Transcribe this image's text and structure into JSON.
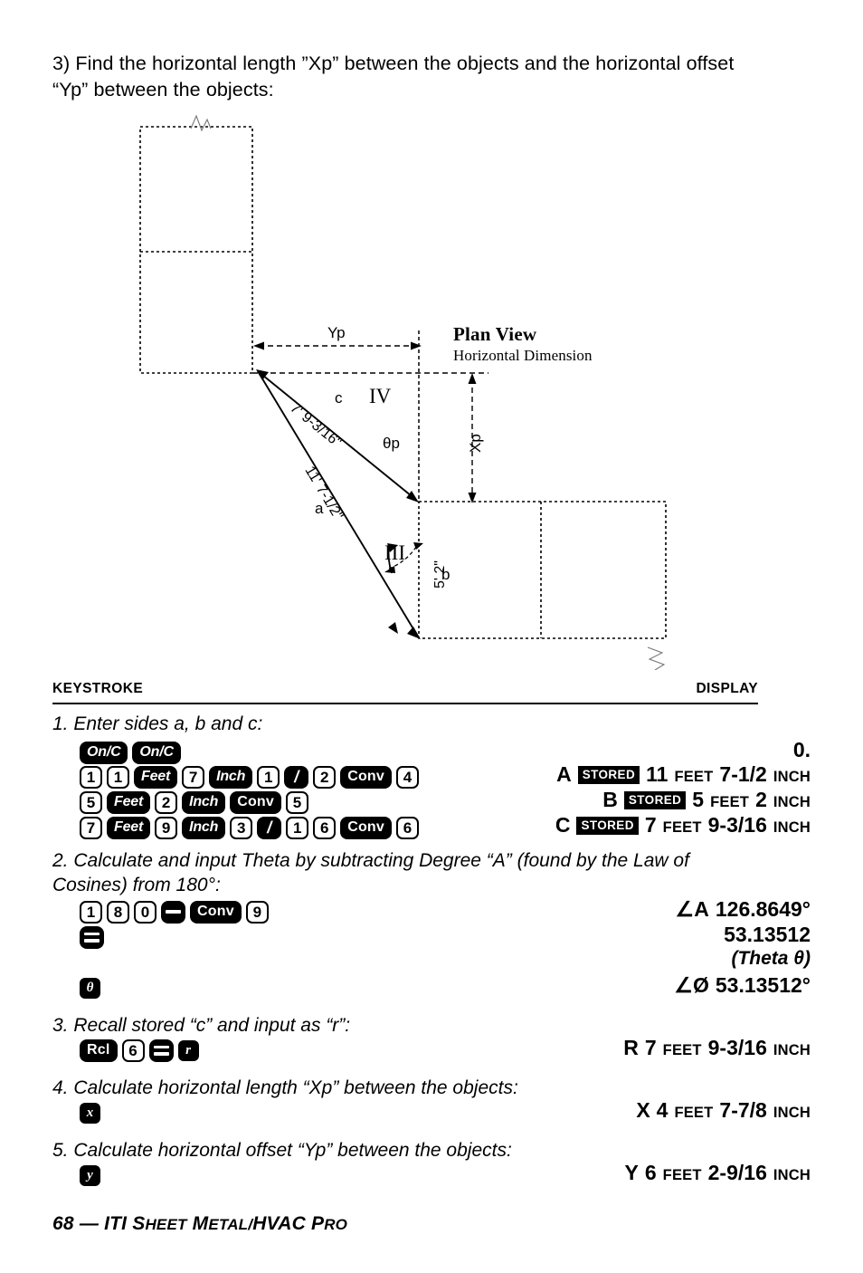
{
  "intro": {
    "text": "3) Find the horizontal length ”Xp” between the objects and the horizontal offset “Yp” between the objects:"
  },
  "diagram": {
    "plan_view_title": "Plan View",
    "plan_view_subtitle": "Horizontal Dimension",
    "labels": {
      "yp": "Yp",
      "xp": "Xp",
      "side_c_letter": "c",
      "side_c_value": "7' 9-3/16\"",
      "side_a_letter": "a",
      "side_a_value": "11' 7-1/2\"",
      "side_b_letter": "b",
      "side_b_value": "5' 2\"",
      "theta": "θp",
      "quadrant_iv": "IV",
      "quadrant_iii": "III"
    }
  },
  "table": {
    "header_keystroke": "KEYSTROKE",
    "header_display": "DISPLAY"
  },
  "steps": [
    {
      "id": "step1",
      "text": "1. Enter sides a, b and c:",
      "rows": [
        {
          "keys": [
            {
              "type": "fn",
              "label": "On/C"
            },
            {
              "type": "fn",
              "label": "On/C"
            }
          ],
          "display": [
            {
              "kind": "big",
              "text": "0."
            }
          ]
        },
        {
          "keys": [
            {
              "type": "num",
              "label": "1"
            },
            {
              "type": "num",
              "label": "1"
            },
            {
              "type": "fn",
              "label": "Feet"
            },
            {
              "type": "num",
              "label": "7"
            },
            {
              "type": "fn",
              "label": "Inch"
            },
            {
              "type": "num",
              "label": "1"
            },
            {
              "type": "slash",
              "label": "/"
            },
            {
              "type": "num",
              "label": "2"
            },
            {
              "type": "fn-upright",
              "label": "Conv"
            },
            {
              "type": "num",
              "label": "4"
            }
          ],
          "display": [
            {
              "kind": "lbl",
              "text": "A"
            },
            {
              "kind": "stored",
              "text": "STORED"
            },
            {
              "kind": "big",
              "text": "11"
            },
            {
              "kind": "small",
              "text": "FEET"
            },
            {
              "kind": "big",
              "text": "7-1/2"
            },
            {
              "kind": "small",
              "text": "INCH"
            }
          ]
        },
        {
          "keys": [
            {
              "type": "num",
              "label": "5"
            },
            {
              "type": "fn",
              "label": "Feet"
            },
            {
              "type": "num",
              "label": "2"
            },
            {
              "type": "fn",
              "label": "Inch"
            },
            {
              "type": "fn-upright",
              "label": "Conv"
            },
            {
              "type": "num",
              "label": "5"
            }
          ],
          "display": [
            {
              "kind": "lbl",
              "text": "B"
            },
            {
              "kind": "stored",
              "text": "STORED"
            },
            {
              "kind": "big",
              "text": "5"
            },
            {
              "kind": "small",
              "text": "FEET"
            },
            {
              "kind": "big",
              "text": "2"
            },
            {
              "kind": "small",
              "text": "INCH"
            }
          ]
        },
        {
          "keys": [
            {
              "type": "num",
              "label": "7"
            },
            {
              "type": "fn",
              "label": "Feet"
            },
            {
              "type": "num",
              "label": "9"
            },
            {
              "type": "fn",
              "label": "Inch"
            },
            {
              "type": "num",
              "label": "3"
            },
            {
              "type": "slash",
              "label": "/"
            },
            {
              "type": "num",
              "label": "1"
            },
            {
              "type": "num",
              "label": "6"
            },
            {
              "type": "fn-upright",
              "label": "Conv"
            },
            {
              "type": "num",
              "label": "6"
            }
          ],
          "display": [
            {
              "kind": "lbl",
              "text": "C"
            },
            {
              "kind": "stored",
              "text": "STORED"
            },
            {
              "kind": "big",
              "text": "7"
            },
            {
              "kind": "small",
              "text": "FEET"
            },
            {
              "kind": "big",
              "text": "9-3/16"
            },
            {
              "kind": "small",
              "text": "INCH"
            }
          ]
        }
      ]
    },
    {
      "id": "step2",
      "text": "2. Calculate and input Theta by subtracting Degree “A” (found by the Law of Cosines) from 180°:",
      "rows": [
        {
          "keys": [
            {
              "type": "num",
              "label": "1"
            },
            {
              "type": "num",
              "label": "8"
            },
            {
              "type": "num",
              "label": "0"
            },
            {
              "type": "minus",
              "label": "−"
            },
            {
              "type": "fn-upright",
              "label": "Conv"
            },
            {
              "type": "num",
              "label": "9"
            }
          ],
          "display": [
            {
              "kind": "lbl",
              "text": "∠A"
            },
            {
              "kind": "big",
              "text": "126.8649°"
            }
          ]
        },
        {
          "keys": [
            {
              "type": "equals",
              "label": "="
            }
          ],
          "display": [
            {
              "kind": "big",
              "text": "53.13512"
            }
          ]
        },
        {
          "keys": [],
          "display": [
            {
              "kind": "ital",
              "text": "(Theta θ)"
            }
          ]
        },
        {
          "keys": [
            {
              "type": "var",
              "label": "θ"
            }
          ],
          "display": [
            {
              "kind": "lbl",
              "text": "∠Ø"
            },
            {
              "kind": "big",
              "text": "53.13512°"
            }
          ]
        }
      ]
    },
    {
      "id": "step3",
      "text": "3. Recall stored “c” and input as “r”:",
      "rows": [
        {
          "keys": [
            {
              "type": "fn-upright",
              "label": "Rcl"
            },
            {
              "type": "num",
              "label": "6"
            },
            {
              "type": "equals",
              "label": "="
            },
            {
              "type": "var",
              "label": "r"
            }
          ],
          "display": [
            {
              "kind": "lbl",
              "text": "R"
            },
            {
              "kind": "big",
              "text": "7"
            },
            {
              "kind": "small",
              "text": "FEET"
            },
            {
              "kind": "big",
              "text": "9-3/16"
            },
            {
              "kind": "small",
              "text": "INCH"
            }
          ]
        }
      ]
    },
    {
      "id": "step4",
      "text": "4. Calculate horizontal length “Xp” between the objects:",
      "rows": [
        {
          "keys": [
            {
              "type": "var",
              "label": "x"
            }
          ],
          "display": [
            {
              "kind": "lbl",
              "text": "X"
            },
            {
              "kind": "big",
              "text": "4"
            },
            {
              "kind": "small",
              "text": "FEET"
            },
            {
              "kind": "big",
              "text": "7-7/8"
            },
            {
              "kind": "small",
              "text": "INCH"
            }
          ]
        }
      ]
    },
    {
      "id": "step5",
      "text": "5. Calculate horizontal offset “Yp” between the objects:",
      "rows": [
        {
          "keys": [
            {
              "type": "var",
              "label": "y"
            }
          ],
          "display": [
            {
              "kind": "lbl",
              "text": "Y"
            },
            {
              "kind": "big",
              "text": "6"
            },
            {
              "kind": "small",
              "text": "FEET"
            },
            {
              "kind": "big",
              "text": "2-9/16"
            },
            {
              "kind": "small",
              "text": "INCH"
            }
          ]
        }
      ]
    }
  ],
  "footer": {
    "page": "68",
    "dash": "—",
    "title_a": "ITI",
    "title_b": "S",
    "title_b_small": "HEET",
    "title_c": "M",
    "title_c_small": "ETAL/",
    "title_d": "HVAC",
    "title_e": "P",
    "title_e_small": "RO"
  },
  "colors": {
    "ink": "#000000",
    "paper": "#ffffff"
  }
}
